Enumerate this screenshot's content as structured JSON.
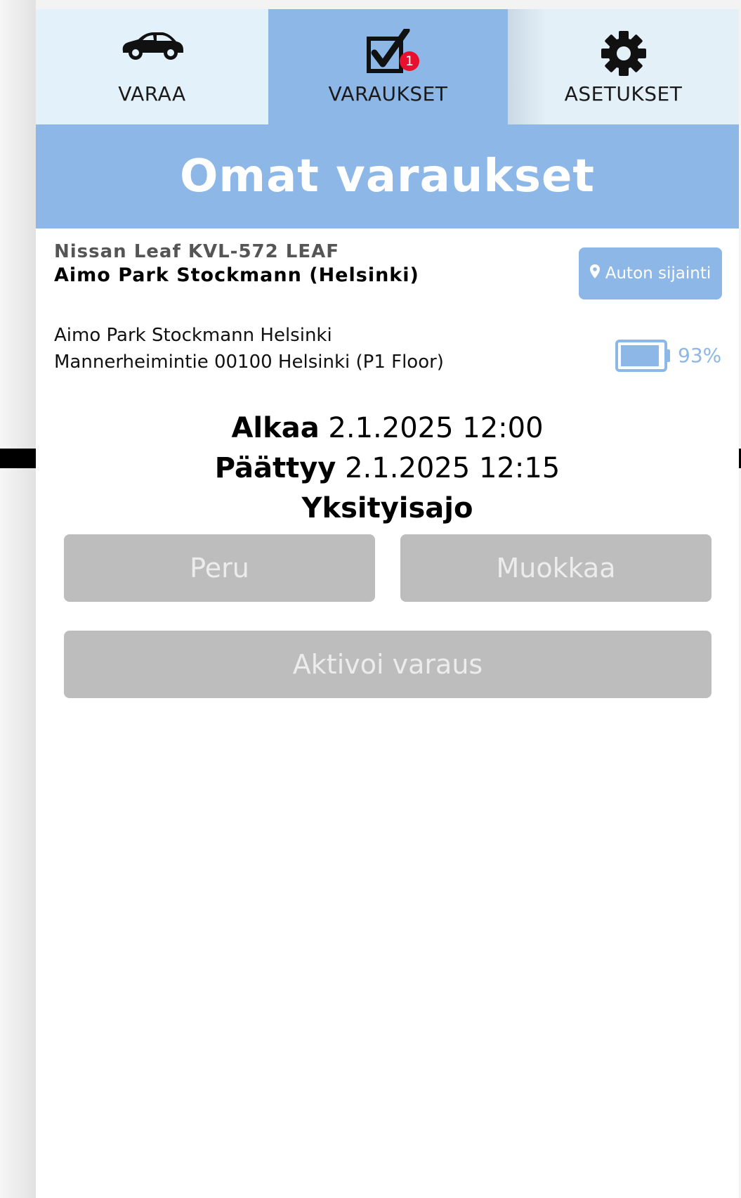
{
  "tabs": [
    {
      "label": "VARAA",
      "icon": "car-icon",
      "active": false
    },
    {
      "label": "VARAUKSET",
      "icon": "checkbox-icon",
      "active": true,
      "badge": "1"
    },
    {
      "label": "ASETUKSET",
      "icon": "gear-icon",
      "active": false
    }
  ],
  "header": {
    "title": "Omat varaukset"
  },
  "reservation": {
    "car_model": "Nissan Leaf KVL-572 LEAF",
    "station_name": "Aimo Park Stockmann (Helsinki)",
    "location_button": "Auton sijainti",
    "address_line1": "Aimo Park Stockmann Helsinki",
    "address_line2": "Mannerheimintie 00100 Helsinki (P1 Floor)",
    "battery": {
      "percent_label": "93%",
      "level": 0.93
    },
    "start_label": "Alkaa",
    "start_value": "2.1.2025 12:00",
    "end_label": "Päättyy",
    "end_value": "2.1.2025 12:15",
    "trip_type": "Yksityisajo"
  },
  "actions": {
    "cancel": "Peru",
    "edit": "Muokkaa",
    "activate": "Aktivoi varaus"
  },
  "colors": {
    "accent": "#8cb7e6",
    "tab_bg": "#e3f1fa",
    "badge": "#e8102f",
    "disabled_button": "#bdbdbd"
  }
}
